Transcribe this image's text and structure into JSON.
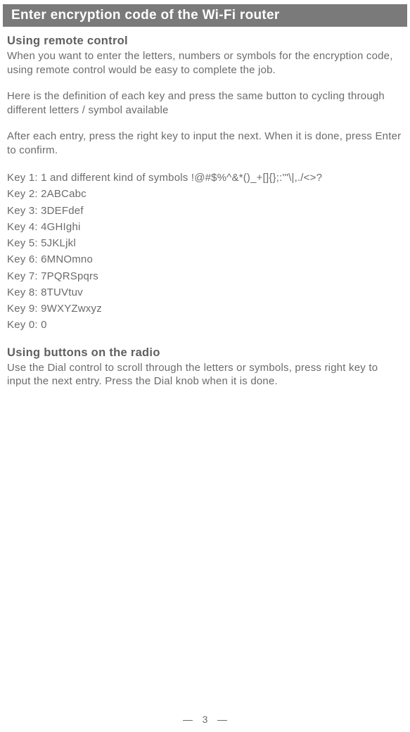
{
  "header": {
    "title": "Enter encryption code of the Wi-Fi router"
  },
  "section1": {
    "heading": "Using remote control",
    "para1": "When you want to enter the letters, numbers or symbols for the encryption code, using remote control would be easy to complete the job.",
    "para2": "Here is the definition of each key and press the same button to cycling through different letters / symbol available",
    "para3": "After each entry, press the right key  to input the next. When it is done, press Enter to confirm.",
    "keys": [
      "Key 1: 1 and different kind of symbols !@#$%^&*()_+[]{};:'\"\\|,./<>?",
      "Key 2: 2ABCabc",
      "Key 3: 3DEFdef",
      "Key 4: 4GHIghi",
      "Key 5: 5JKLjkl",
      "Key 6: 6MNOmno",
      "Key 7: 7PQRSpqrs",
      "Key 8: 8TUVtuv",
      "Key 9: 9WXYZwxyz",
      "Key 0: 0"
    ]
  },
  "section2": {
    "heading": "Using buttons on the radio",
    "para1": "Use the Dial control to scroll through the letters or symbols, press right key to input the next entry. Press the Dial knob when it is done."
  },
  "footer": {
    "page_number": "3"
  }
}
